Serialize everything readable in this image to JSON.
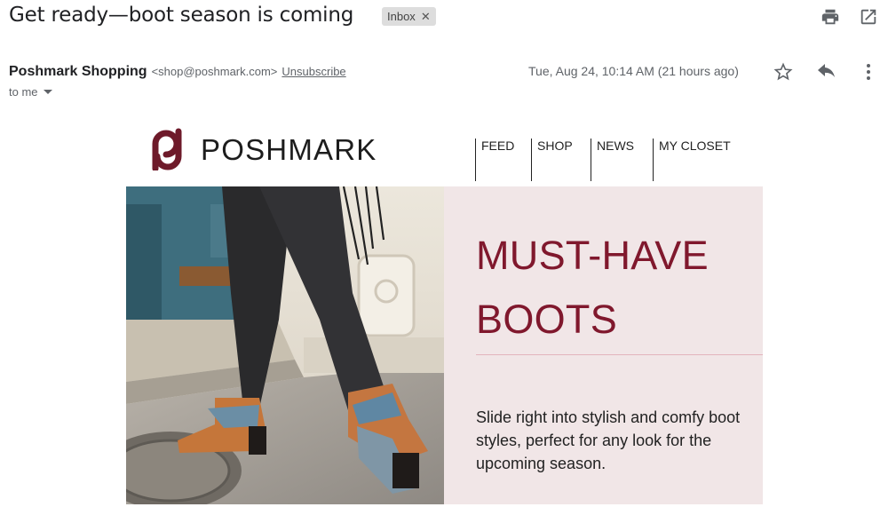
{
  "email": {
    "subject": "Get ready—boot season is coming",
    "label": "Inbox",
    "sender_name": "Poshmark Shopping",
    "sender_email": "<shop@poshmark.com>",
    "unsubscribe": "Unsubscribe",
    "recipient": "to me",
    "date": "Tue, Aug 24, 10:14 AM (21 hours ago)"
  },
  "icons": {
    "print": "print-icon",
    "open_new_window": "open-in-new-window-icon",
    "star": "star-icon",
    "reply": "reply-icon",
    "more": "more-vert-icon",
    "label_remove": "close-icon",
    "recipient_details": "chevron-down-icon"
  },
  "newsletter": {
    "brand": "POSHMARK",
    "nav": [
      "FEED",
      "SHOP",
      "NEWS",
      "MY CLOSET"
    ],
    "hero_title": "MUST-HAVE BOOTS",
    "hero_copy": "Slide right into stylish and comfy boot styles, perfect for any look for the upcoming season.",
    "accent_color": "#80182d",
    "panel_color": "#f1e6e7"
  }
}
